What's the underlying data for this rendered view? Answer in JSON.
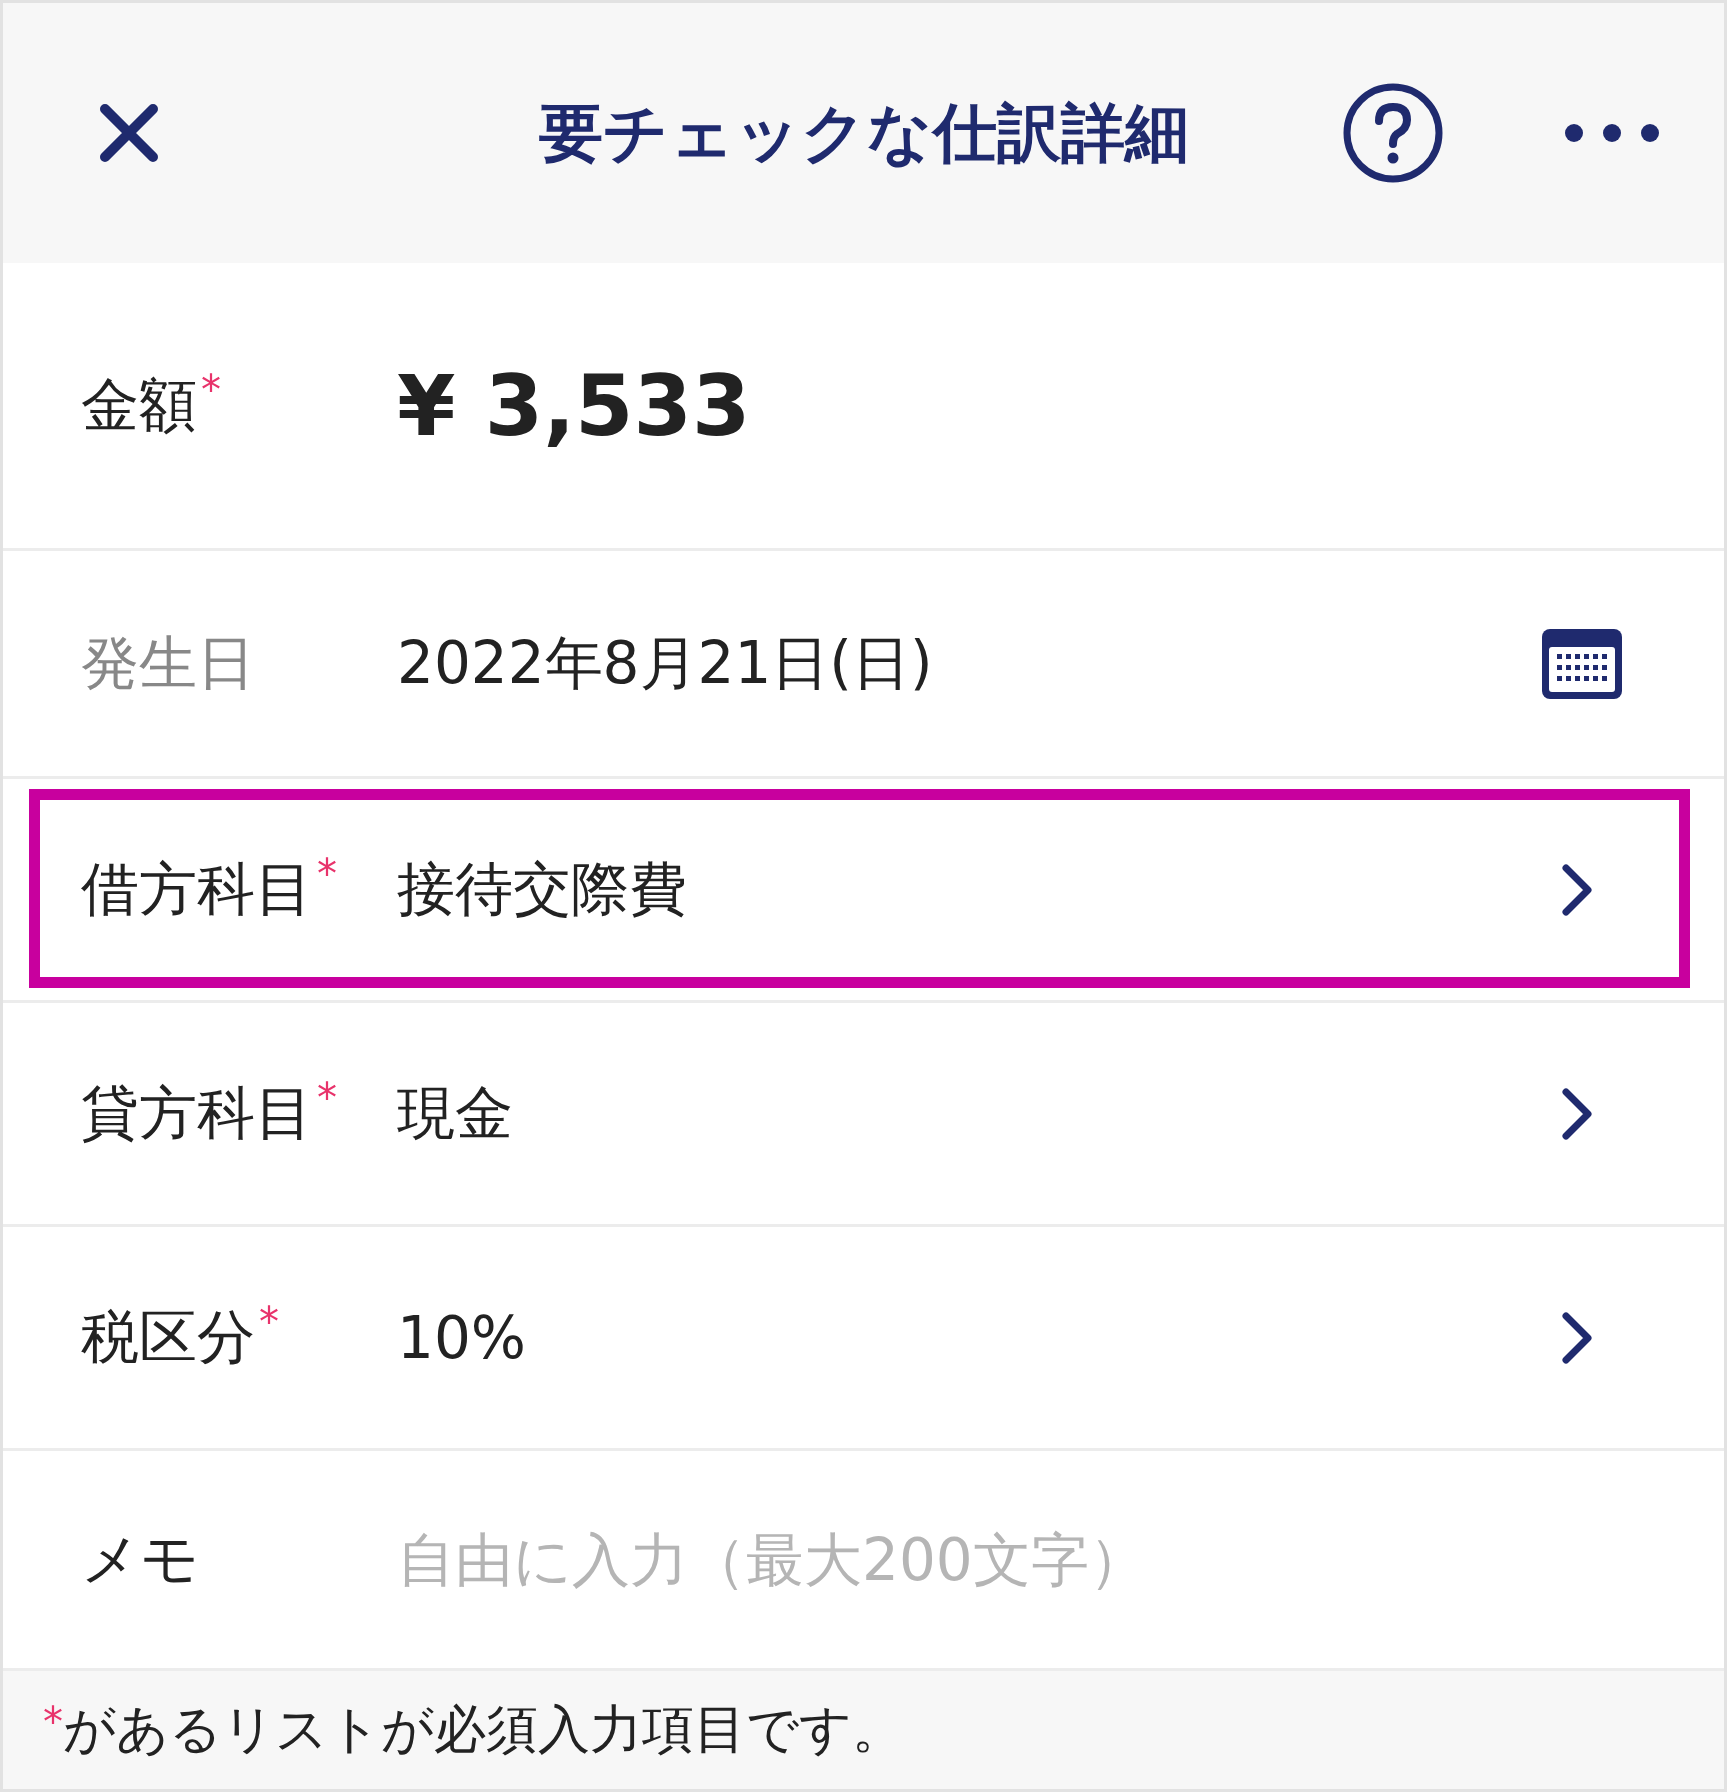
{
  "header": {
    "title": "要チェックな仕訳詳細"
  },
  "fields": [
    {
      "kind": "amount",
      "label": "金額",
      "required_mark": "*",
      "value": "¥ 3,533",
      "muted": false
    },
    {
      "kind": "date",
      "label": "発生日",
      "value": "2022年8月21日(日)",
      "muted": true
    },
    {
      "kind": "select",
      "label": "借方科目",
      "required_mark": "*",
      "value": "接待交際費",
      "muted": false,
      "highlighted": true
    },
    {
      "kind": "select",
      "label": "貸方科目",
      "required_mark": "*",
      "value": "現金",
      "muted": false
    },
    {
      "kind": "select",
      "label": "税区分",
      "required_mark": "*",
      "value": "10%",
      "muted": false
    },
    {
      "kind": "memo",
      "label": "メモ",
      "placeholder": "自由に入力（最大200文字）",
      "muted": false
    }
  ],
  "footer": {
    "mark": "*",
    "note": "があるリストが必須入力項目です。"
  }
}
